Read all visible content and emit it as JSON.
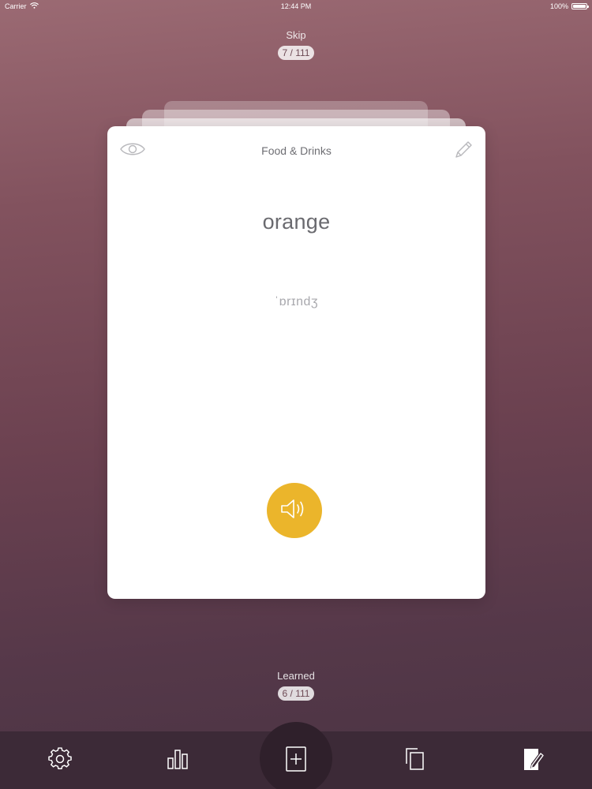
{
  "status_bar": {
    "carrier": "Carrier",
    "time": "12:44 PM",
    "battery": "100%",
    "battery_level": 1.0
  },
  "skip": {
    "label": "Skip",
    "count": "7 / 111"
  },
  "card": {
    "category": "Food & Drinks",
    "word": "orange",
    "transcription": "ˈɒrɪndʒ",
    "sound_button_color": "#ebb52b",
    "icons": {
      "reveal": "eye-icon",
      "edit": "pencil-icon",
      "sound": "speaker-icon"
    }
  },
  "learned": {
    "label": "Learned",
    "count": "6 / 111"
  },
  "toolbar": {
    "items": [
      {
        "icon": "gear-icon"
      },
      {
        "icon": "bar-chart-icon"
      },
      {
        "icon": "add-card-icon"
      },
      {
        "icon": "copy-cards-icon"
      },
      {
        "icon": "note-edit-icon"
      }
    ]
  },
  "colors": {
    "accent": "#ebb52b",
    "toolbar_bg": "#3c2a37",
    "background_top": "#9b6a73",
    "background_bottom": "#4a3443"
  }
}
